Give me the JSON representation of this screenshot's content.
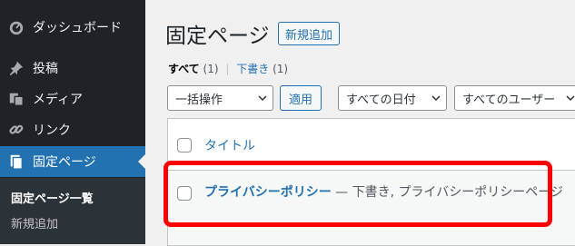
{
  "sidebar": {
    "items": [
      {
        "label": "ダッシュボード",
        "icon": "dashboard-icon"
      },
      {
        "label": "投稿",
        "icon": "pushpin-icon"
      },
      {
        "label": "メディア",
        "icon": "media-icon"
      },
      {
        "label": "リンク",
        "icon": "link-icon"
      },
      {
        "label": "固定ページ",
        "icon": "page-icon",
        "current": true
      }
    ],
    "submenu": [
      {
        "label": "固定ページ一覧",
        "active": true
      },
      {
        "label": "新規追加"
      }
    ]
  },
  "header": {
    "title": "固定ページ",
    "add_new_label": "新規追加"
  },
  "filters": {
    "all_label": "すべて",
    "all_count": "(1)",
    "separator": "|",
    "draft_label": "下書き",
    "draft_count": "(1)"
  },
  "bulk": {
    "action_value": "一括操作",
    "apply_label": "適用",
    "date_value": "すべての日付",
    "user_value": "すべてのユーザー"
  },
  "table": {
    "column_title": "タイトル",
    "rows": [
      {
        "title": "プライバシーポリシー",
        "state": " — 下書き, プライバシーポリシーページ"
      }
    ]
  },
  "colors": {
    "accent": "#2271b1",
    "sidebar_bg": "#1d2327",
    "highlight": "#ff0000"
  }
}
